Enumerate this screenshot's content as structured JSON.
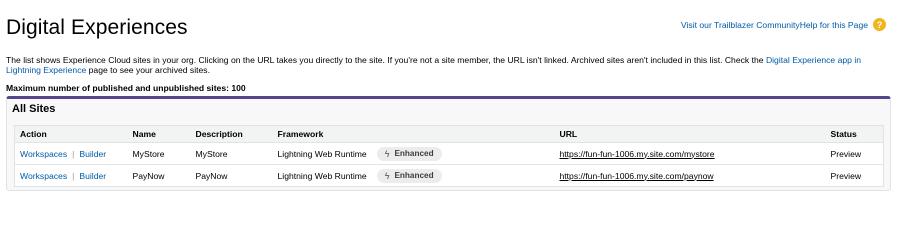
{
  "header": {
    "title": "Digital Experiences",
    "trailblazer_link": "Visit our Trailblazer Community",
    "help_link": "Help for this Page",
    "help_icon": "help-icon",
    "help_icon_glyph": "?"
  },
  "intro": {
    "text": "The list shows Experience Cloud sites in your org. Clicking on the URL takes you directly to the site. If you're not a site member, the URL isn't linked. Archived sites aren't included in this list. Check the ",
    "link": "Digital Experience app in Lightning Experience",
    "text_after": " page to see your archived sites.",
    "max_sites": "Maximum number of published and unpublished sites: 100"
  },
  "panel": {
    "title": "All Sites",
    "columns": [
      "Action",
      "Name",
      "Description",
      "Framework",
      "URL",
      "Status"
    ],
    "rows": [
      {
        "actions": [
          "Workspaces",
          "Builder"
        ],
        "name": "MyStore",
        "description": "MyStore",
        "framework": "Lightning Web Runtime",
        "badge": "Enhanced",
        "url": "https://fun-fun-1006.my.site.com/mystore",
        "status": "Preview"
      },
      {
        "actions": [
          "Workspaces",
          "Builder"
        ],
        "name": "PayNow",
        "description": "PayNow",
        "framework": "Lightning Web Runtime",
        "badge": "Enhanced",
        "url": "https://fun-fun-1006.my.site.com/paynow",
        "status": "Preview"
      }
    ],
    "action_separator": "|",
    "badge_icon": "bolt-icon",
    "badge_icon_glyph": "ϟ"
  },
  "colors": {
    "link": "#015ba7",
    "panel_accent": "#56458c",
    "help_icon": "#f2b51c"
  }
}
